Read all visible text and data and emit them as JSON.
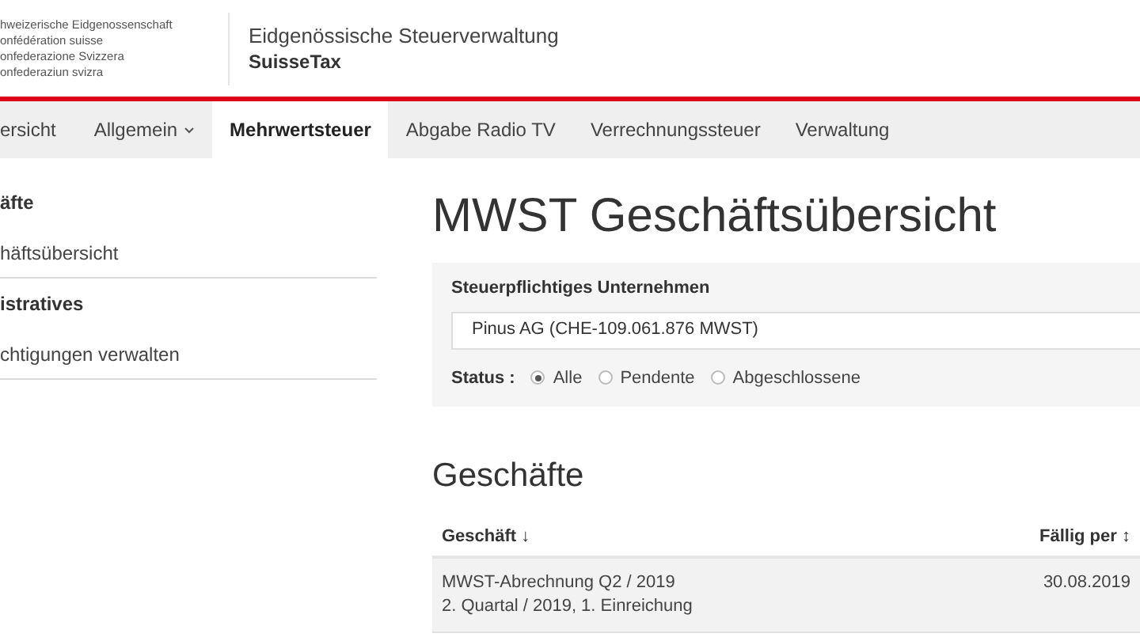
{
  "header": {
    "confederation_lines": [
      "hweizerische Eidgenossenschaft",
      "onfédération suisse",
      "onfederazione Svizzera",
      "onfederaziun svizra"
    ],
    "agency": "Eidgenössische Steuerverwaltung",
    "app_name": "SuisseTax"
  },
  "nav": [
    {
      "label": "ersicht",
      "selected": false,
      "dropdown": false
    },
    {
      "label": "Allgemein",
      "selected": false,
      "dropdown": true
    },
    {
      "label": "Mehrwertsteuer",
      "selected": true,
      "dropdown": false
    },
    {
      "label": "Abgabe Radio TV",
      "selected": false,
      "dropdown": false
    },
    {
      "label": "Verrechnungssteuer",
      "selected": false,
      "dropdown": false
    },
    {
      "label": "Verwaltung",
      "selected": false,
      "dropdown": false
    }
  ],
  "sidebar": [
    {
      "heading": "äfte",
      "items": [
        "häftsübersicht"
      ]
    },
    {
      "heading": "istratives",
      "items": [
        "chtigungen verwalten"
      ]
    }
  ],
  "page_title": "MWST Geschäftsübersicht",
  "filter": {
    "label": "Steuerpflichtiges Unternehmen",
    "value": "Pinus AG (CHE-109.061.876 MWST)",
    "status_label": "Status :",
    "options": [
      {
        "label": "Alle",
        "selected": true
      },
      {
        "label": "Pendente",
        "selected": false
      },
      {
        "label": "Abgeschlossene",
        "selected": false
      }
    ]
  },
  "section_title": "Geschäfte",
  "table": {
    "columns": [
      {
        "label": "Geschäft",
        "sort": "↓"
      },
      {
        "label": "Fällig per",
        "sort": "↕"
      }
    ],
    "rows": [
      {
        "title": "MWST-Abrechnung Q2 / 2019",
        "subtitle": "2. Quartal / 2019, 1. Einreichung",
        "due": "30.08.2019"
      }
    ]
  }
}
